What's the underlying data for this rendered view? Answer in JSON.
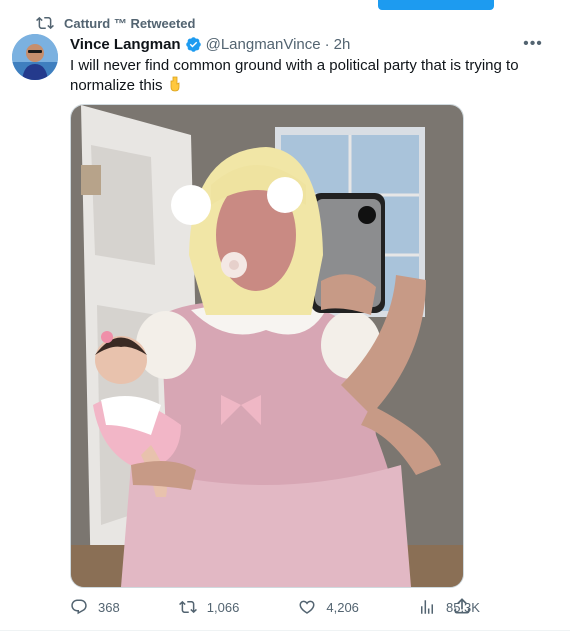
{
  "retweet_banner": {
    "text": "Catturd ™ Retweeted",
    "icon": "retweet-icon"
  },
  "tweet": {
    "author_name": "Vince Langman",
    "handle": "@LangmanVince",
    "separator": "·",
    "time": "2h",
    "verified": true,
    "text": "I will never find common ground with a political party that is trying to normalize this",
    "emoji": "👇",
    "media_alt": ""
  },
  "actions": {
    "replies": "368",
    "retweets": "1,066",
    "likes": "4,206",
    "views": "85.3K"
  },
  "icons": {
    "reply": "reply-icon",
    "retweet": "retweet-icon",
    "like": "heart-icon",
    "views": "views-icon",
    "share": "share-icon",
    "more": "more-icon"
  },
  "colors": {
    "accent": "#1d9bf0",
    "text": "#0f1419",
    "muted": "#536471"
  }
}
